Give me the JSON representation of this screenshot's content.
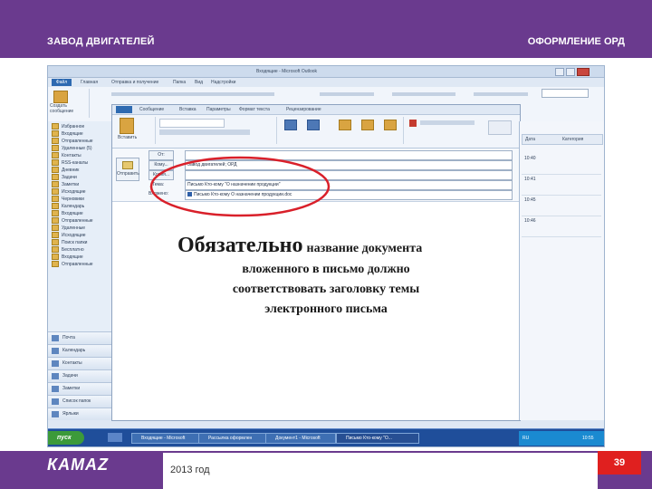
{
  "slide": {
    "header_left": "ЗАВОД ДВИГАТЕЛЕЙ",
    "header_right": "ОФОРМЛЕНИЕ ОРД",
    "logo": "КАМАZ",
    "year": "2013 год",
    "page_number": "39",
    "note_big": "Обязательно",
    "note_small": "название документа",
    "note_line2": "вложенного в письмо должно",
    "note_line3": "соответствовать заголовку темы",
    "note_line4": "электронного письма"
  },
  "outlook": {
    "window_title": "Входящие - Microsoft Outlook",
    "quick_tab_file": "Файл",
    "ribbon_tabs": [
      "Главная",
      "Отправка и получение",
      "Папка",
      "Вид",
      "Надстройки"
    ],
    "message_tabs": [
      "Сообщение",
      "Вставка",
      "Параметры",
      "Формат текста",
      "Рецензирование"
    ],
    "ribbon_buttons": {
      "new_mail": "Создать сообщение",
      "send": "Отправить",
      "paste": "Вставить",
      "reply": "Ответить",
      "forward": "Переслать"
    },
    "nav_folders": [
      "Избранное",
      "Входящие",
      "Отправленные",
      "Удаленные (5)",
      "Контакты",
      "RSS-каналы",
      "Дневник",
      "Задачи",
      "Заметки",
      "Исходящие",
      "Черновики",
      "Календарь",
      "Входящие",
      "Отправленные",
      "Удаленные",
      "Исходящие",
      "Поиск папки",
      "Бесплатно",
      "Входящие",
      "Отправленные"
    ],
    "nav_buttons": [
      "Почта",
      "Календарь",
      "Контакты",
      "Задачи",
      "Заметки",
      "Список папок",
      "Ярлыки"
    ],
    "compose": {
      "from_label": "От:",
      "to_label": "Кому...",
      "cc_label": "Копия...",
      "subject_label": "Тема:",
      "attached_label": "Вложено:",
      "send_button": "Отправить",
      "to_value": "Завод двигателей; ОРД",
      "subject_value": "Письмо Кто-кому \"О назначении продукции\"",
      "attachment_value": "Письмо Кто-кому О назначении продукции.doc"
    },
    "right_pane": {
      "header1": "Дата",
      "header2": "Категория",
      "items": [
        "10:40",
        "10:41",
        "10:45",
        "10:46"
      ]
    },
    "taskbar": {
      "start_label": "пуск",
      "windows": [
        "Входящие - Microsoft",
        "Рассылка оформлен",
        "Документ1 - Microsoft",
        "Письмо Кто-кому \"О..."
      ],
      "clock": "10:55",
      "language": "RU"
    }
  },
  "colors": {
    "brand_purple": "#6a3a8e",
    "accent_red": "#e0201f",
    "annotation_ellipse": "#d9202a"
  }
}
